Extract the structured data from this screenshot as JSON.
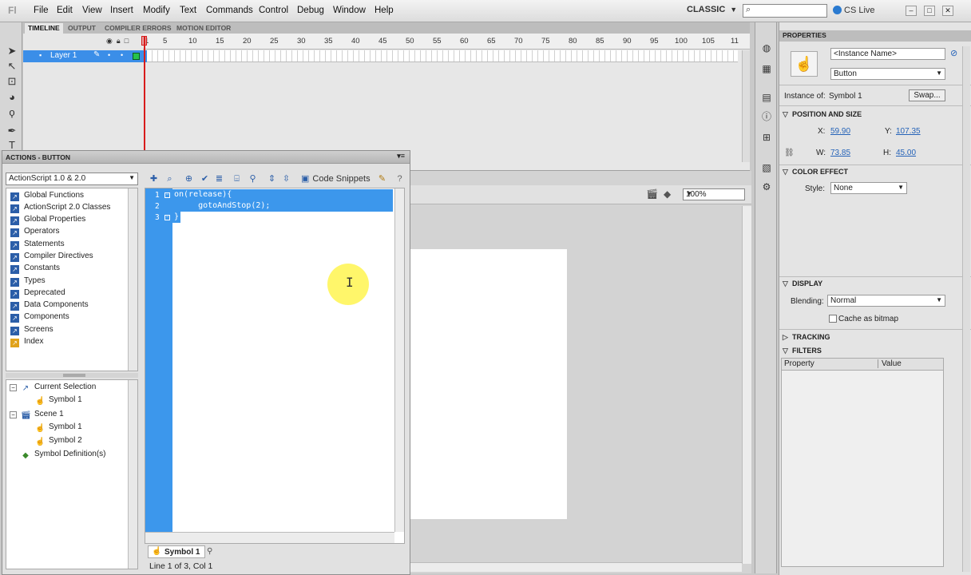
{
  "app": {
    "logo": "Fl"
  },
  "menu": [
    "File",
    "Edit",
    "View",
    "Insert",
    "Modify",
    "Text",
    "Commands",
    "Control",
    "Debug",
    "Window",
    "Help"
  ],
  "workspace": {
    "label": "CLASSIC"
  },
  "search": {
    "icon": "search-icon"
  },
  "cslive": {
    "label": "CS Live"
  },
  "window_buttons": [
    "minimize-icon",
    "maximize-icon",
    "close-icon"
  ],
  "timeline": {
    "tabs": [
      "TIMELINE",
      "OUTPUT",
      "COMPILER ERRORS",
      "MOTION EDITOR"
    ],
    "active_tab": 0,
    "ruler_numbers": [
      "1",
      "5",
      "10",
      "15",
      "20",
      "25",
      "30",
      "35",
      "40",
      "45",
      "50",
      "55",
      "60",
      "65",
      "70",
      "75",
      "80",
      "85",
      "90",
      "95",
      "100",
      "105",
      "11"
    ],
    "layer": {
      "name": "Layer 1"
    }
  },
  "stage": {
    "zoom": "100%"
  },
  "actions": {
    "title": "ACTIONS - BUTTON",
    "language": "ActionScript 1.0 & 2.0",
    "book": [
      "Global Functions",
      "ActionScript 2.0 Classes",
      "Global Properties",
      "Operators",
      "Statements",
      "Compiler Directives",
      "Constants",
      "Types",
      "Deprecated",
      "Data Components",
      "Components",
      "Screens",
      "Index"
    ],
    "tree": {
      "current_selection": "Current Selection",
      "current_symbol": "Symbol 1",
      "scene": "Scene 1",
      "scene_symbols": [
        "Symbol 1",
        "Symbol 2"
      ],
      "definitions": "Symbol Definition(s)"
    },
    "code_snippets": "Code Snippets",
    "code": {
      "line_numbers": [
        "1",
        "2",
        "3"
      ],
      "lines": [
        "on(release){",
        "     gotoAndStop(2);",
        "}"
      ]
    },
    "script_tab": "Symbol 1",
    "status": "Line 1 of 3, Col 1"
  },
  "properties": {
    "title": "PROPERTIES",
    "instance_name_placeholder": "<Instance Name>",
    "type": "Button",
    "instance_of_label": "Instance of:",
    "instance_of": "Symbol 1",
    "swap": "Swap...",
    "position_section": "POSITION AND SIZE",
    "x_label": "X:",
    "x": "59.90",
    "y_label": "Y:",
    "y": "107.35",
    "w_label": "W:",
    "w": "73.85",
    "h_label": "H:",
    "h": "45.00",
    "color_section": "COLOR EFFECT",
    "style_label": "Style:",
    "style": "None",
    "display_section": "DISPLAY",
    "blending_label": "Blending:",
    "blending": "Normal",
    "cache_label": "Cache as bitmap",
    "tracking_section": "TRACKING",
    "filters_section": "FILTERS",
    "filters_columns": [
      "Property",
      "Value"
    ]
  }
}
